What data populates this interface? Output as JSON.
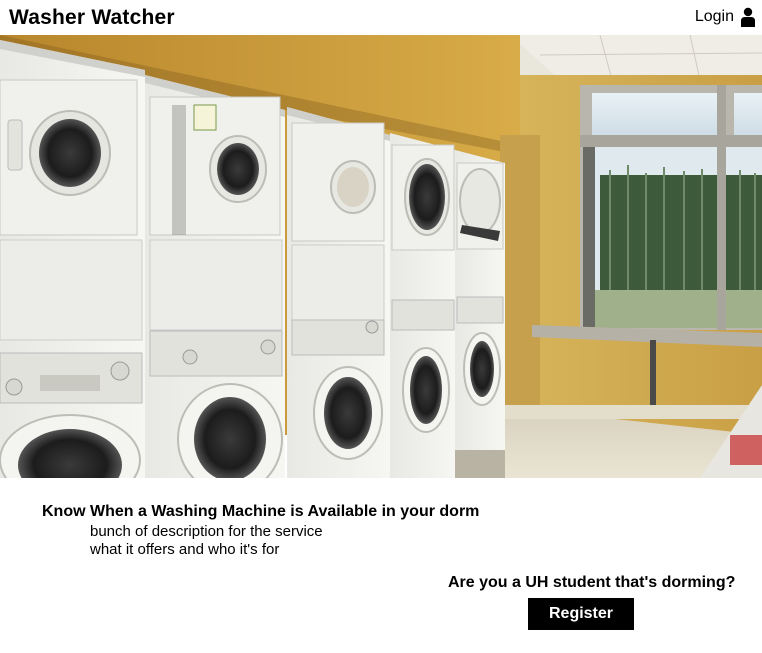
{
  "header": {
    "brand": "Washer Watcher",
    "login_label": "Login",
    "login_icon": "user-icon"
  },
  "hero": {
    "image": "laundry-room-photo"
  },
  "main": {
    "headline": "Know When a Washing Machine is Available in your dorm",
    "description_lines": [
      "bunch of description for the service",
      "what it offers and who it's for"
    ]
  },
  "cta": {
    "question": "Are you a UH student that's dorming?",
    "register_label": "Register"
  }
}
